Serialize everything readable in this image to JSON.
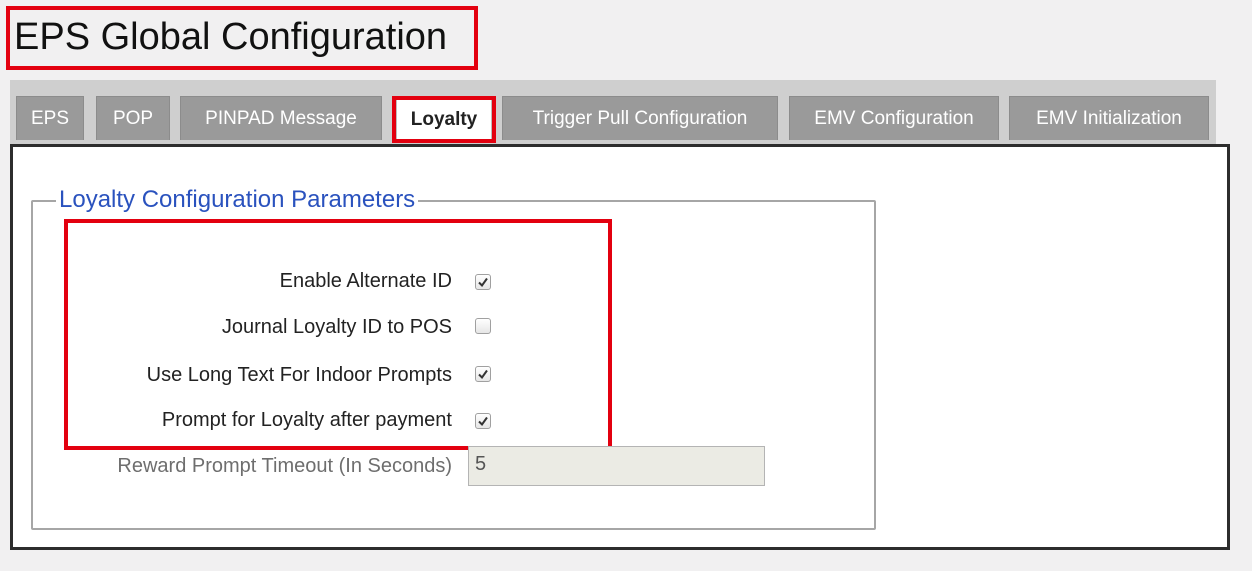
{
  "page": {
    "title": "EPS Global Configuration"
  },
  "tabs": [
    {
      "label": "EPS",
      "active": false
    },
    {
      "label": "POP",
      "active": false
    },
    {
      "label": "PINPAD Message",
      "active": false
    },
    {
      "label": "Loyalty",
      "active": true
    },
    {
      "label": "Trigger Pull Configuration",
      "active": false
    },
    {
      "label": "EMV Configuration",
      "active": false
    },
    {
      "label": "EMV Initialization",
      "active": false
    }
  ],
  "loyalty_panel": {
    "legend": "Loyalty Configuration Parameters",
    "options": [
      {
        "label": "Enable Alternate ID",
        "checked": true
      },
      {
        "label": "Journal Loyalty ID to POS",
        "checked": false
      },
      {
        "label": "Use Long Text For Indoor Prompts",
        "checked": true
      },
      {
        "label": "Prompt for Loyalty after payment",
        "checked": true
      }
    ],
    "reward_timeout": {
      "label": "Reward Prompt Timeout (In Seconds)",
      "value": "5",
      "disabled": true
    }
  },
  "colors": {
    "highlight": "#e3000f",
    "legend_text": "#2a52be",
    "tab_inactive": "#9a9a9a",
    "tab_active": "#ffffff"
  }
}
